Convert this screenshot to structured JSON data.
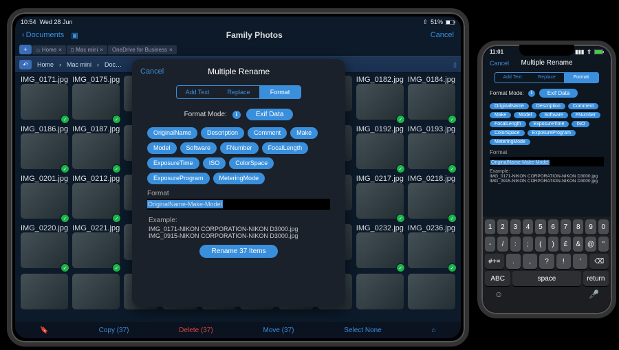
{
  "ipad": {
    "status_time": "10:54",
    "status_date": "Wed 28 Jun",
    "status_battery": "51%",
    "nav_back": "Documents",
    "nav_title": "Family Photos",
    "nav_cancel": "Cancel",
    "tabs": [
      "Home",
      "Mac mini",
      "OneDrive for Business"
    ],
    "breadcrumbs": [
      "Home",
      "Mac mini",
      "Doc…"
    ],
    "thumbnails": [
      "IMG_0171.jpg",
      "IMG_0175.jpg",
      "",
      "",
      "",
      "",
      "",
      "",
      "IMG_0182.jpg",
      "IMG_0184.jpg",
      "IMG_0186.jpg",
      "IMG_0187.jpg",
      "",
      "",
      "",
      "",
      "",
      "",
      "IMG_0192.jpg",
      "IMG_0193.jpg",
      "IMG_0201.jpg",
      "IMG_0212.jpg",
      "",
      "",
      "",
      "",
      "",
      "",
      "IMG_0217.jpg",
      "IMG_0218.jpg",
      "IMG_0220.jpg",
      "IMG_0221.jpg",
      "",
      "",
      "",
      "",
      "",
      "",
      "IMG_0232.jpg",
      "IMG_0236.jpg",
      "",
      "",
      "",
      "",
      "",
      "",
      "",
      "",
      "",
      ""
    ],
    "toolbar": {
      "copy": "Copy (37)",
      "delete": "Delete (37)",
      "move": "Move (37)",
      "select_none": "Select None"
    }
  },
  "dialog": {
    "cancel": "Cancel",
    "title": "Multiple Rename",
    "segments": [
      "Add Text",
      "Replace",
      "Format"
    ],
    "segment_selected": 2,
    "mode_label": "Format Mode:",
    "mode_value": "Exif Data",
    "tags": [
      "OriginalName",
      "Description",
      "Comment",
      "Make",
      "Model",
      "Software",
      "FNumber",
      "FocalLength",
      "ExposureTime",
      "ISO",
      "ColorSpace",
      "ExposureProgram",
      "MeteringMode"
    ],
    "format_label": "Format",
    "format_value": "OriginalName-Make-Model",
    "example_label": "Example:",
    "example_lines": [
      "IMG_0171-NIKON CORPORATION-NIKON D3000.jpg",
      "IMG_0915-NIKON CORPORATION-NIKON D3000.jpg"
    ],
    "rename_btn": "Rename 37 Items"
  },
  "iphone": {
    "status_time": "11:01",
    "nav_cancel": "Cancel",
    "nav_title": "Multiple Rename",
    "key_abc": "ABC",
    "key_space": "space",
    "key_return": "return",
    "row1": [
      "1",
      "2",
      "3",
      "4",
      "5",
      "6",
      "7",
      "8",
      "9",
      "0"
    ],
    "row2": [
      "-",
      "/",
      ":",
      ";",
      "(",
      ")",
      "£",
      "&",
      "@",
      "\""
    ],
    "row3": [
      "#+=",
      ".",
      ",",
      "?",
      "!",
      "'",
      "⌫"
    ]
  }
}
